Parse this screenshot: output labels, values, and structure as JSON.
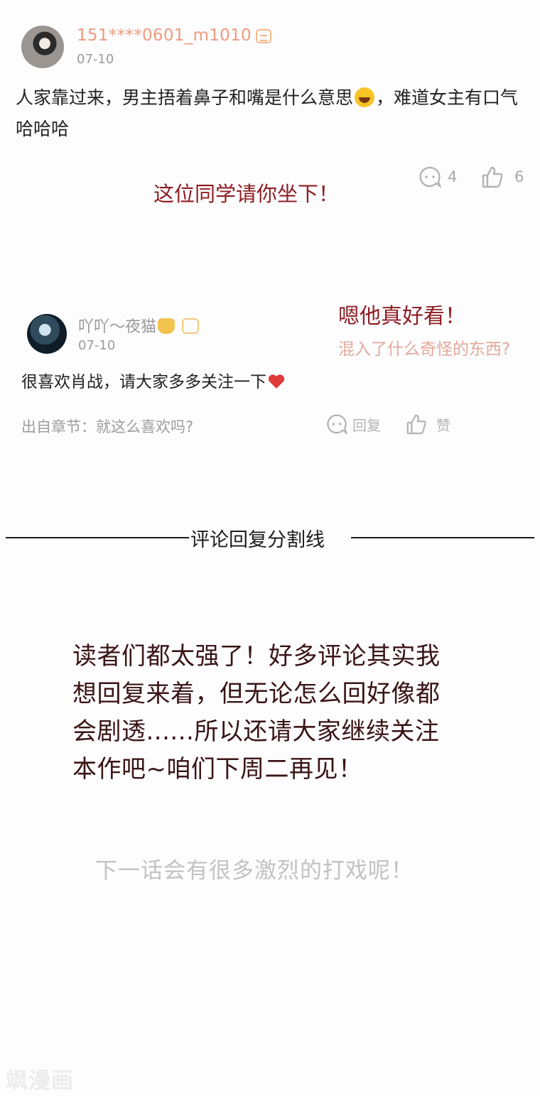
{
  "comment1": {
    "username": "151****0601_m1010",
    "date": "07-10",
    "body_before_emoji": "人家靠过来，男主捂着鼻子和嘴是什么意思",
    "emoji": "face-with-tears-of-joy",
    "body_after_emoji": "，难道女主有口气哈哈哈",
    "reply_count": "4",
    "like_count": "6"
  },
  "annotation_red_1": "这位同学请你坐下！",
  "comment2": {
    "username": "吖吖～夜猫",
    "date": "07-10",
    "body": "很喜欢肖战，请大家多多关注一下",
    "source": "出自章节：就这么喜欢吗?",
    "reply_label": "回复",
    "like_label": "赞"
  },
  "annotation_red_2": "嗯他真好看！",
  "annotation_pink": "混入了什么奇怪的东西?",
  "divider": {
    "text": "评论回复分割线"
  },
  "author_note": {
    "lines": [
      "读者们都太强了！好多评论其实我",
      "想回复来着，但无论怎么回好像都",
      "会剧透......所以还请大家继续关注",
      "本作吧~咱们下周二再见！"
    ]
  },
  "next_chapter_note": "下一话会有很多激烈的打戏呢！",
  "watermark": "飒漫画",
  "colors": {
    "username_orange": "#ef9a7d",
    "annotation_red": "#8e1e24",
    "annotation_pink": "#e3a99b",
    "muted_gray": "#9a9a9a"
  }
}
